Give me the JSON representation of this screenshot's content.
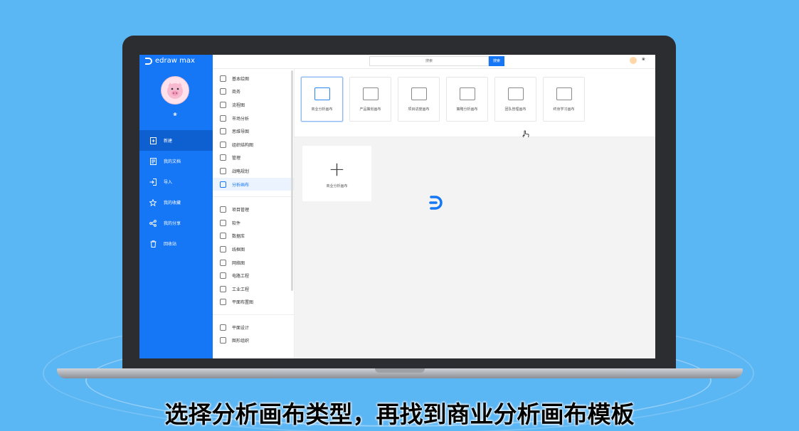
{
  "app": {
    "name": "edraw max"
  },
  "user": {
    "name": "❀"
  },
  "nav": {
    "items": [
      {
        "label": "新建",
        "icon": "new-file-icon",
        "active": true
      },
      {
        "label": "我的文档",
        "icon": "document-icon",
        "active": false
      },
      {
        "label": "导入",
        "icon": "import-icon",
        "active": false
      },
      {
        "label": "我的收藏",
        "icon": "star-icon",
        "active": false
      },
      {
        "label": "我的分享",
        "icon": "share-icon",
        "active": false
      },
      {
        "label": "回收站",
        "icon": "trash-icon",
        "active": false
      }
    ]
  },
  "search": {
    "placeholder": "搜索",
    "button": "搜索"
  },
  "categories": {
    "group1": [
      {
        "label": "基本绘图",
        "icon": "basic-drawing-icon"
      },
      {
        "label": "商务",
        "icon": "briefcase-icon"
      },
      {
        "label": "流程图",
        "icon": "flowchart-icon"
      },
      {
        "label": "市场分析",
        "icon": "market-chart-icon"
      },
      {
        "label": "思维导图",
        "icon": "mindmap-icon"
      },
      {
        "label": "组织结构图",
        "icon": "org-chart-icon"
      },
      {
        "label": "管理",
        "icon": "management-icon"
      },
      {
        "label": "战略规划",
        "icon": "strategy-icon"
      },
      {
        "label": "分析画布",
        "icon": "canvas-icon",
        "active": true
      }
    ],
    "group2": [
      {
        "label": "项目管理",
        "icon": "gantt-icon"
      },
      {
        "label": "软件",
        "icon": "software-icon"
      },
      {
        "label": "数据库",
        "icon": "database-icon"
      },
      {
        "label": "线框图",
        "icon": "wireframe-icon"
      },
      {
        "label": "网络图",
        "icon": "network-icon"
      },
      {
        "label": "电路工程",
        "icon": "circuit-icon"
      },
      {
        "label": "工业工程",
        "icon": "industrial-icon"
      },
      {
        "label": "平面布置图",
        "icon": "floorplan-icon"
      }
    ],
    "group3": [
      {
        "label": "平面设计",
        "icon": "graphic-design-icon"
      },
      {
        "label": "图形组织",
        "icon": "graphic-organizer-icon"
      }
    ]
  },
  "types": [
    {
      "label": "商业分析画布",
      "icon": "business-canvas-icon",
      "selected": true
    },
    {
      "label": "产品策划画布",
      "icon": "product-plan-icon",
      "selected": false
    },
    {
      "label": "项目进度画布",
      "icon": "project-progress-icon",
      "selected": false
    },
    {
      "label": "策略分析画布",
      "icon": "strategy-analysis-icon",
      "selected": false
    },
    {
      "label": "团队管理画布",
      "icon": "team-icon",
      "selected": false
    },
    {
      "label": "终身学习画布",
      "icon": "lifelong-learning-icon",
      "selected": false
    }
  ],
  "blank_template": {
    "label": "商业分析画布"
  },
  "subtitle": "选择分析画布类型，再找到商业分析画布模板",
  "colors": {
    "accent": "#1576f6",
    "background": "#5bb6f4"
  }
}
